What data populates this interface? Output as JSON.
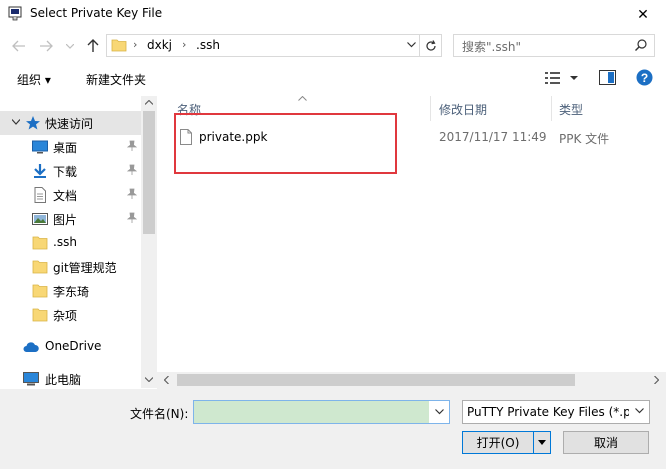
{
  "window": {
    "title": "Select Private Key File",
    "close_label": "✕"
  },
  "address": {
    "crumbs": [
      "dxkj",
      ".ssh"
    ],
    "search_placeholder": "搜索\".ssh\""
  },
  "toolbar": {
    "organize_label": "组织 ▾",
    "new_folder_label": "新建文件夹"
  },
  "sidebar": {
    "items": [
      {
        "label": "快速访问",
        "icon": "star-icon"
      },
      {
        "label": "桌面",
        "icon": "desktop-icon",
        "pinned": true
      },
      {
        "label": "下载",
        "icon": "download-icon",
        "pinned": true
      },
      {
        "label": "文档",
        "icon": "document-icon",
        "pinned": true
      },
      {
        "label": "图片",
        "icon": "picture-icon",
        "pinned": true
      },
      {
        "label": ".ssh",
        "icon": "folder-icon"
      },
      {
        "label": "git管理规范",
        "icon": "folder-icon"
      },
      {
        "label": "李东琦",
        "icon": "folder-icon"
      },
      {
        "label": "杂项",
        "icon": "folder-icon"
      },
      {
        "label": "OneDrive",
        "icon": "cloud-icon"
      },
      {
        "label": "此电脑",
        "icon": "computer-icon"
      }
    ]
  },
  "columns": {
    "name": "名称",
    "date": "修改日期",
    "type": "类型"
  },
  "files": [
    {
      "name": "private.ppk",
      "date": "2017/11/17 11:49",
      "type": "PPK 文件"
    }
  ],
  "footer": {
    "filename_label": "文件名(N):",
    "filename_value": "",
    "filter_value": "PuTTY Private Key Files (*.pp",
    "open_label": "打开(O)",
    "cancel_label": "取消"
  },
  "colors": {
    "highlight_box": "#e0383e",
    "filename_bg": "#cfe8cf",
    "accent": "#0078d7"
  }
}
